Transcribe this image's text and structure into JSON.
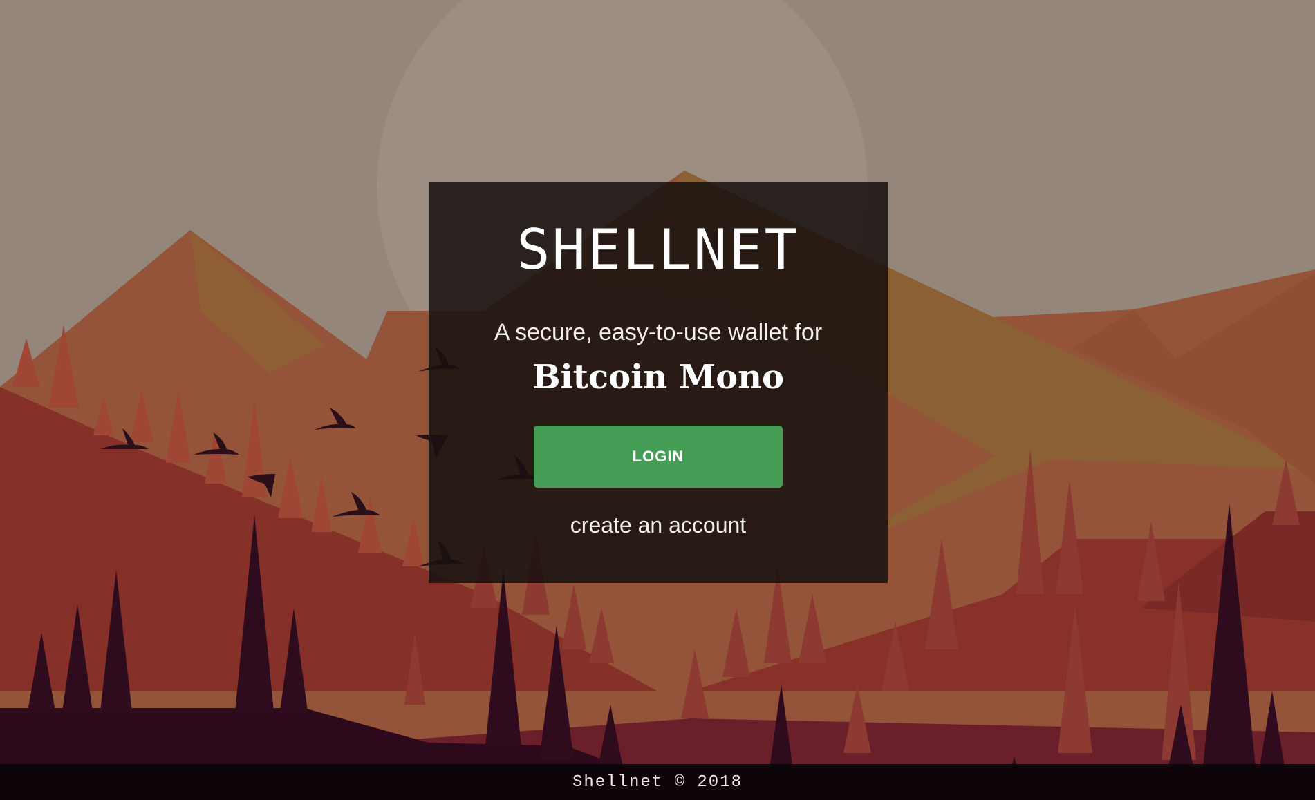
{
  "app": {
    "brand": "SHELLNET",
    "tagline": "A secure, easy-to-use wallet for",
    "coin_name": "Bitcoin Mono"
  },
  "actions": {
    "login_label": "LOGIN",
    "create_account_label": "create an account"
  },
  "footer": {
    "text": "Shellnet © 2018"
  },
  "colors": {
    "sky": "#94867a",
    "panel": "#16100e",
    "login_button": "#449d55",
    "footer": "#080306"
  },
  "background": {
    "icon": "mountain-forest-landscape"
  }
}
